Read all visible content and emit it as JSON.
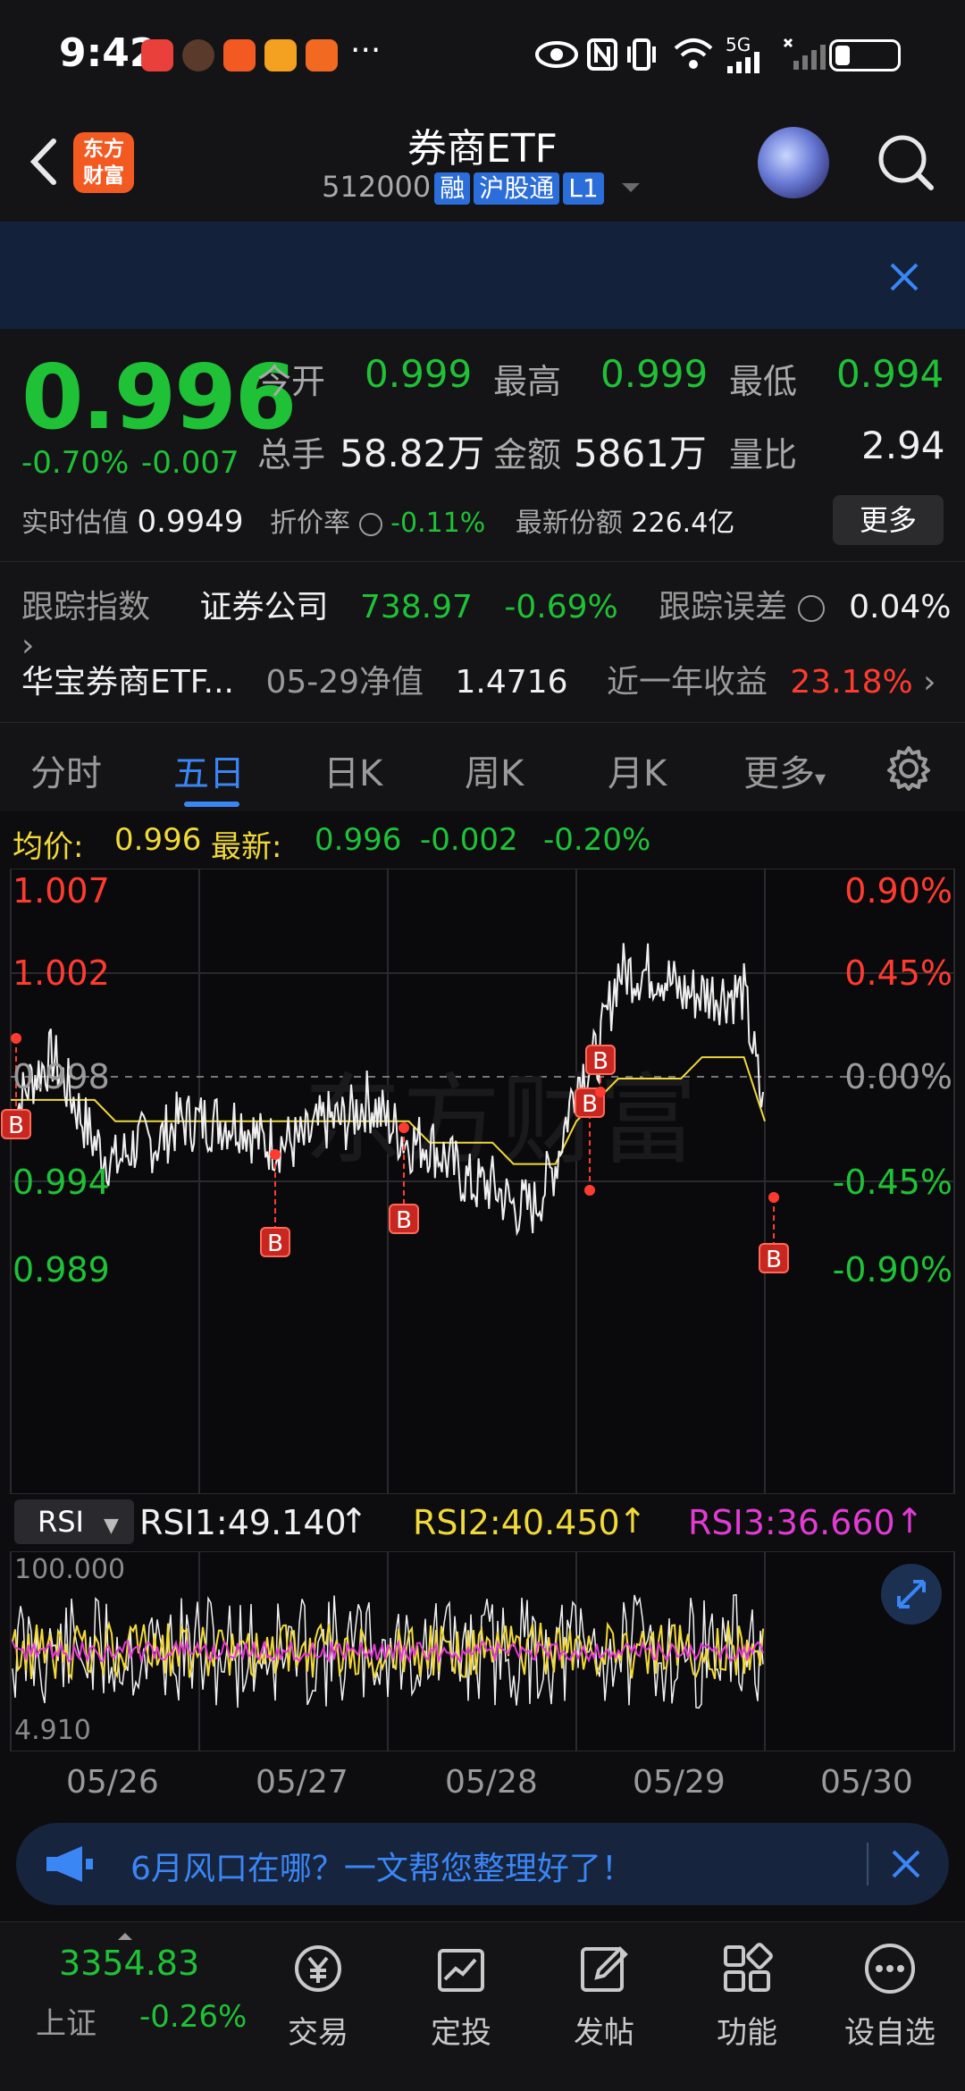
{
  "status": {
    "time": "9:42",
    "more": "···",
    "net": "5G"
  },
  "header": {
    "title": "券商ETF",
    "code": "512000",
    "tags": [
      "融",
      "沪股通",
      "L1"
    ],
    "logo_line1": "东方",
    "logo_line2": "财富"
  },
  "quote": {
    "price": "0.996",
    "pct": "-0.70%",
    "chg": "-0.007",
    "open_label": "今开",
    "open": "0.999",
    "high_label": "最高",
    "high": "0.999",
    "low_label": "最低",
    "low": "0.994",
    "vol_label": "总手",
    "vol": "58.82万",
    "amt_label": "金额",
    "amt": "5861万",
    "ratio_label": "量比",
    "ratio": "2.94",
    "est_label": "实时估值",
    "est": "0.9949",
    "disc_label": "折价率",
    "disc": "-0.11%",
    "share_label": "最新份额",
    "share": "226.4亿",
    "more_btn": "更多"
  },
  "tracking": {
    "label": "跟踪指数",
    "index": "证券公司",
    "value": "738.97",
    "pct": "-0.69%",
    "err_label": "跟踪误差",
    "err": "0.04%"
  },
  "fund": {
    "name": "华宝券商ETF...",
    "nav_label": "05-29净值",
    "nav": "1.4716",
    "ret_label": "近一年收益",
    "ret": "23.18%"
  },
  "tabs": [
    "分时",
    "五日",
    "日K",
    "周K",
    "月K",
    "更多"
  ],
  "chart_info": {
    "avg_label": "均价:",
    "avg": "0.996",
    "last_label": "最新:",
    "last": "0.996",
    "last_chg": "-0.002",
    "last_pct": "-0.20%"
  },
  "chart_data": {
    "type": "line",
    "x": [
      "05/26",
      "05/27",
      "05/28",
      "05/29",
      "05/30"
    ],
    "y_left_ticks": [
      "1.007",
      "1.002",
      "0.998",
      "0.994",
      "0.989"
    ],
    "y_right_ticks": [
      "0.90%",
      "0.45%",
      "0.00%",
      "-0.45%",
      "-0.90%"
    ],
    "ylim": [
      0.989,
      1.007
    ],
    "series": [
      {
        "values": [
          0.996,
          0.998,
          0.999,
          0.997,
          0.995,
          0.994,
          0.995,
          0.995,
          0.996,
          0.996,
          0.996,
          0.996,
          0.995,
          0.995,
          0.995,
          0.996,
          0.996,
          0.997,
          0.996,
          0.995,
          0.995,
          0.994,
          0.993,
          0.993,
          0.992,
          0.992,
          0.994,
          0.998,
          0.999,
          1.003,
          1.003,
          1.003,
          1.002,
          1.002,
          1.002,
          1.002,
          0.996
        ]
      },
      {
        "values": [
          0.997,
          0.997,
          0.997,
          0.997,
          0.997,
          0.996,
          0.996,
          0.996,
          0.996,
          0.996,
          0.996,
          0.996,
          0.996,
          0.996,
          0.996,
          0.996,
          0.996,
          0.996,
          0.996,
          0.996,
          0.995,
          0.995,
          0.995,
          0.995,
          0.994,
          0.994,
          0.994,
          0.996,
          0.997,
          0.998,
          0.998,
          0.998,
          0.998,
          0.999,
          0.999,
          0.999,
          0.996
        ]
      }
    ],
    "markers": [
      "B",
      "B",
      "B",
      "B",
      "B",
      "B"
    ]
  },
  "rsi": {
    "select": "RSI",
    "rsi1": "RSI1:49.140",
    "rsi2": "RSI2:40.450",
    "rsi3": "RSI3:36.660",
    "top": "100.000",
    "bottom": "4.910"
  },
  "notice": {
    "text": "6月风口在哪？一文帮您整理好了！"
  },
  "bottom_nav": {
    "index_value": "3354.83",
    "index_name": "上证",
    "index_pct": "-0.26%",
    "items": [
      "交易",
      "定投",
      "发帖",
      "功能",
      "设自选"
    ]
  },
  "colors": {
    "up": "#ff3b30",
    "down": "#1fc236",
    "accent": "#3b86f5"
  }
}
